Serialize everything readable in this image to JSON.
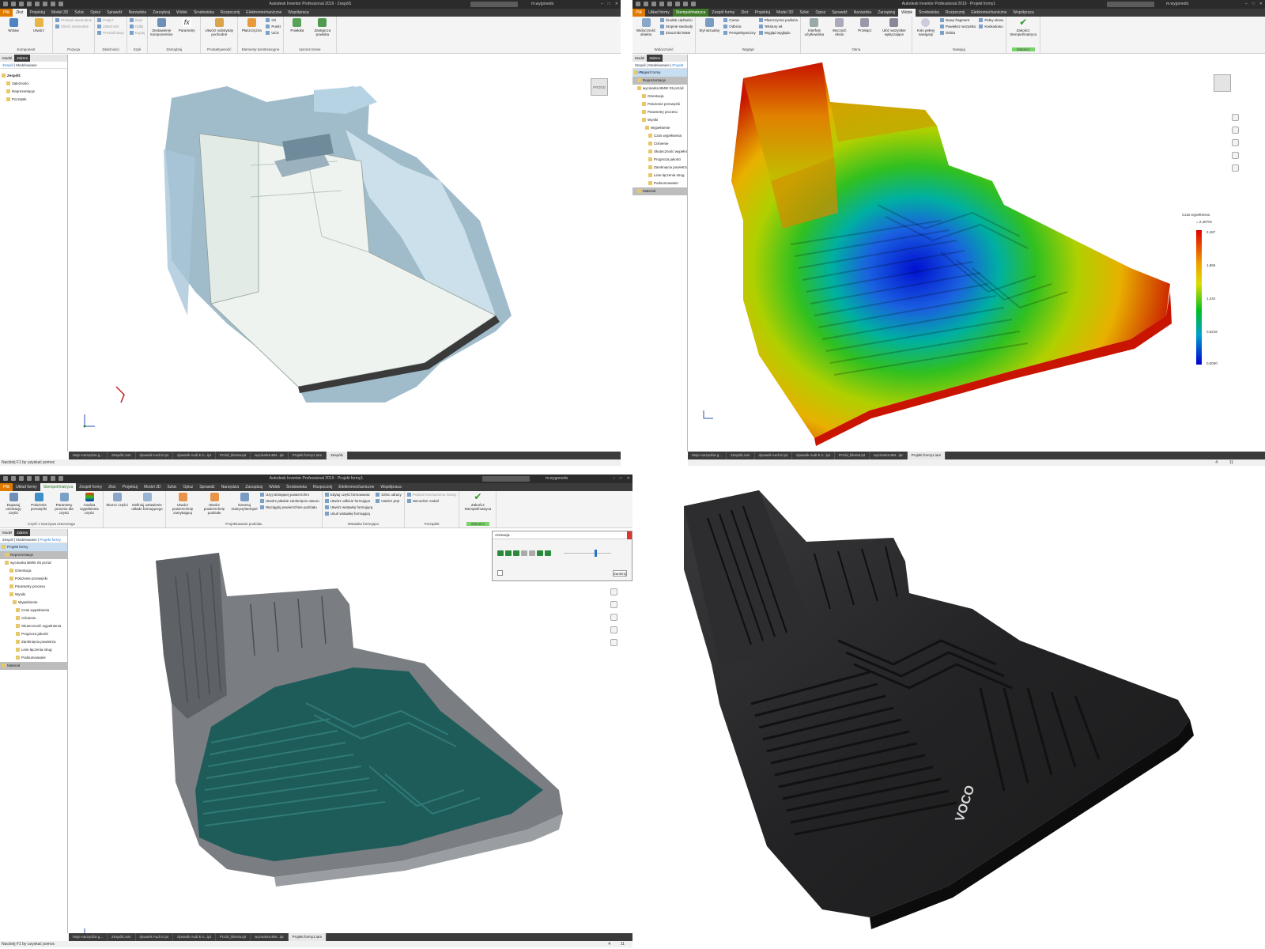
{
  "colors": {
    "title_bar": "#2b2b2b",
    "tab_bar": "#3b3b3b",
    "file_tab": "#e07b00",
    "ribbon": "#f4f4f4",
    "accent_green": "#3f7a2a",
    "selection": "#c6ddf2"
  },
  "top_left": {
    "app_title": "Autodesk Inventor Professional 2019 · Zespół1",
    "search_placeholder": "Wyszukaj w pomocy i poleceniach",
    "user": "m.wygonedo",
    "tabs": [
      "Plik",
      "Złoż",
      "Projektuj",
      "Model 3D",
      "Szkic",
      "Opisz",
      "Sprawdź",
      "Narzędzia",
      "Zarządzaj",
      "Widok",
      "Środowiska",
      "Rozpocznij",
      "Elektromechaniczne",
      "Współpraca"
    ],
    "active_tab": 1,
    "ribbon_groups": [
      {
        "label": "Komponent",
        "buttons": [
          "Wstaw",
          "Utwórz"
        ]
      },
      {
        "label": "Pozycja",
        "list": [
          "Przesuń swobodnie",
          "Obróć swobodnie"
        ]
      },
      {
        "label": "Zależności",
        "list": [
          "Połącz",
          "Zależność",
          "Prostoliniowy"
        ]
      },
      {
        "label": "Szyk",
        "list": [
          "Szyk",
          "Odbij",
          "Kopiuj"
        ]
      },
      {
        "label": "Zarządzaj",
        "buttons": [
          "Zestawienie komponentów",
          "Parametry"
        ]
      },
      {
        "label": "Produktywność",
        "buttons": [
          "Utwórz substytuty pochodne"
        ]
      },
      {
        "label": "Elementy konstrukcyjne",
        "buttons": [
          "Płaszczyzna"
        ],
        "list": [
          "Oś",
          "Punkt",
          "UCS"
        ]
      },
      {
        "label": "Uproszczenie",
        "buttons": [
          "Powłoka",
          "Zastępcza powłoka"
        ]
      }
    ],
    "browser_tabs": [
      "Model",
      "Zakres"
    ],
    "browser_sub": [
      "Zespół",
      "Modelowanie"
    ],
    "tree": [
      "Zespół1",
      "Zależności",
      "Reprezentacje",
      "Początek"
    ],
    "doc_tabs": [
      "Moje narzędzia g...",
      "Zespół1.iam",
      "dywanik Audi E.ipt",
      "dywanik Audi E n...ipt",
      "Przód_klienta.ipt",
      "wycinarka BM...ipt",
      "Projekt formy1.iam",
      "Zespół1"
    ],
    "status": "Naciśnij F1 by uzyskać pomoc",
    "view_cube": "PRZÓD"
  },
  "top_right": {
    "app_title": "Autodesk Inventor Professional 2019 · Projekt formy1",
    "user": "m.wygonedo",
    "tabs": [
      "Plik",
      "Układ formy",
      "Stempel/matryca",
      "Zespół formy",
      "Złoż",
      "Projektuj",
      "Model 3D",
      "Szkic",
      "Opisz",
      "Sprawdź",
      "Narzędzia",
      "Zarządzaj",
      "Widok",
      "Środowiska",
      "Rozpocznij",
      "Elektromechaniczne",
      "Współpraca"
    ],
    "active_tab": 12,
    "ribbon_groups": [
      {
        "label": "Widoczność",
        "buttons": [
          "Widoczność obiektu"
        ],
        "list": [
          "Środek ciężkości",
          "Stopnie swobody",
          "Znaczniki iMate"
        ]
      },
      {
        "label": "Wygląd",
        "buttons": [
          "Styl wizualny"
        ],
        "list": [
          "Cienie",
          "Odbicia",
          "Perspektywiczny",
          "Płaszczyzna podłoża",
          "Tekstury wł.",
          "Wygląd wyglądu"
        ]
      },
      {
        "label": "Okna",
        "buttons": [
          "Interfejs użytkownika",
          "Wyczyść ekran",
          "Przełącz",
          "Ułóż wszystkie wyłączające"
        ]
      },
      {
        "label": "Nawiguj",
        "buttons": [
          "Koło pełnej nawigacji"
        ],
        "list": [
          "Nowy fragment",
          "Powiększ wszystko",
          "Orbita",
          "Pełny ekran",
          "Kaskadowo"
        ]
      },
      {
        "label": "Zakończ",
        "buttons": [
          "Zakończ Stempel/matryca"
        ]
      }
    ],
    "browser_tabs": [
      "Model",
      "Zakres"
    ],
    "browser_sub": [
      "Zespół",
      "Modelowanie",
      "Projekt formy"
    ],
    "tree": [
      "Projekt formy",
      "Reprezentacje",
      "wycinarka BMW X5 przód",
      "Orientacja",
      "Położenie przewężki",
      "Parametry procesu",
      "Wyniki",
      "Wypełnienie",
      "Czas wypełnienia",
      "Ciśnienie",
      "Skuteczność wypełnienia",
      "Prognoza jakości",
      "Zamknięcia powietrza",
      "Linie łączenia strug",
      "Podsumowanie",
      "Materiał"
    ],
    "legend_title": "Czas wypełnienia",
    "legend_unit": "= 2,4870s",
    "legend_ticks": [
      "2,487",
      "1,866",
      "1,244",
      "0,6218",
      "0,0000"
    ],
    "doc_tabs": [
      "Moje narzędzia g...",
      "Zespół1.iam",
      "dywanik Audi E.ipt",
      "dywanik Audi E n...ipt",
      "Przód_klienta.ipt",
      "wycinarka BM...ipt",
      "Projekt formy1.iam"
    ],
    "status_nums": [
      "4",
      "11"
    ]
  },
  "bottom_left": {
    "app_title": "Autodesk Inventor Professional 2019 · Projekt formy1",
    "user": "m.wygonedo",
    "tabs": [
      "Plik",
      "Układ formy",
      "Stempel/matryca",
      "Zespół formy",
      "Złoż",
      "Projektuj",
      "Model 3D",
      "Szkic",
      "Opisz",
      "Sprawdź",
      "Narzędzia",
      "Zarządzaj",
      "Widok",
      "Środowiska",
      "Rozpocznij",
      "Elektromechaniczne",
      "Współpraca"
    ],
    "active_tab": 2,
    "ribbon_groups": [
      {
        "label": "Część z tworzywa sztucznego",
        "buttons": [
          "Dopasuj orientację części",
          "Położenie przewężki",
          "Parametry procesu dla części",
          "Analiza wypełnienia części"
        ]
      },
      {
        "label": "",
        "buttons": [
          "Skurcz części",
          "Definiuj ustawienie układu formującego"
        ]
      },
      {
        "label": "Projektowanie podziału",
        "buttons": [
          "Utwórz powierzchnię zamykającą",
          "Utwórz powierzchnię podziału",
          "Generuj matrycę/stempel"
        ],
        "list": [
          "Użyj istniejącej powierzchni",
          "Utwórz płaskie zamknięcie otworu",
          "Wyciągnij powierzchnie podziału"
        ]
      },
      {
        "label": "Wstawka formująca",
        "list": [
          "Edytuj część formowania",
          "Utwórz odbicie formujące",
          "Utwórz wstawkę formującą",
          "Usuń wstawkę formującą",
          "Szkic odrazy",
          "Utwórz pręt"
        ]
      },
      {
        "label": "Porządek",
        "list": [
          "Podział mechanizmu ściany",
          "Menedżer zadań"
        ]
      },
      {
        "label": "Zakończ",
        "buttons": [
          "Zakończ Stempel/matryca"
        ]
      }
    ],
    "browser_tabs": [
      "Model",
      "Zakres"
    ],
    "browser_sub": [
      "Zespół",
      "Modelowanie",
      "Projekt formy"
    ],
    "tree": [
      "Projekt formy",
      "Reprezentacje",
      "wycinarka BMW X5 przód",
      "Orientacja",
      "Położenie przewężki",
      "Parametry procesu",
      "Wyniki",
      "Wypełnienie",
      "Czas wypełnienia",
      "Ciśnienie",
      "Skuteczność wypełnienia",
      "Prognoza jakości",
      "Zamknięcia powietrza",
      "Linie łączenia strug",
      "Podsumowanie",
      "Materiał"
    ],
    "animation_title": "Animacja",
    "animation_close": "Zamknij",
    "animation_progress": 0.65,
    "doc_tabs": [
      "Moje narzędzia g...",
      "Zespół1.iam",
      "dywanik Audi E.ipt",
      "dywanik Audi E n...ipt",
      "Przód_klienta.ipt",
      "wycinarka BM...ipt",
      "Projekt formy1.iam"
    ],
    "status": "Naciśnij F1 by uzyskać pomoc",
    "status_nums": [
      "4",
      "11"
    ]
  },
  "bottom_right": {
    "brand": "VOCO"
  }
}
